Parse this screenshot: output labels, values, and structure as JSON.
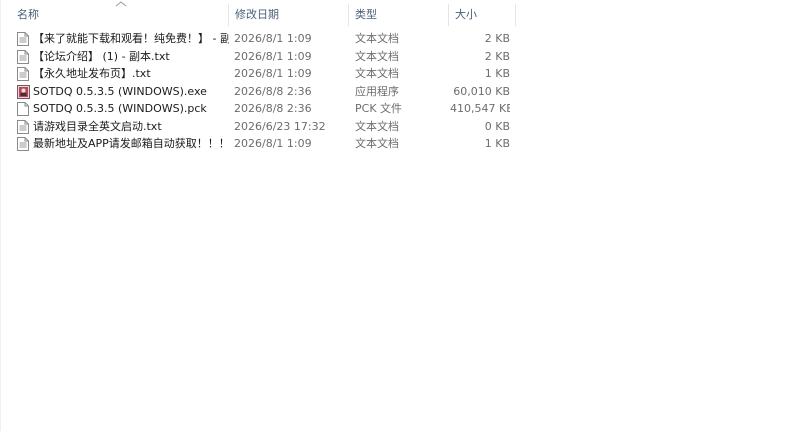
{
  "columns": {
    "name": "名称",
    "date": "修改日期",
    "type": "类型",
    "size": "大小"
  },
  "files": [
    {
      "name": "【来了就能下载和观看！纯免费！】 - 副...",
      "date": "2026/8/1 1:09",
      "type": "文本文档",
      "size": "2 KB",
      "icon": "text-file-icon"
    },
    {
      "name": "【论坛介绍】 (1) - 副本.txt",
      "date": "2026/8/1 1:09",
      "type": "文本文档",
      "size": "2 KB",
      "icon": "text-file-icon"
    },
    {
      "name": "【永久地址发布页】.txt",
      "date": "2026/8/1 1:09",
      "type": "文本文档",
      "size": "1 KB",
      "icon": "text-file-icon"
    },
    {
      "name": "SOTDQ 0.5.3.5 (WINDOWS).exe",
      "date": "2026/8/8 2:36",
      "type": "应用程序",
      "size": "60,010 KB",
      "icon": "application-icon"
    },
    {
      "name": "SOTDQ 0.5.3.5 (WINDOWS).pck",
      "date": "2026/8/8 2:36",
      "type": "PCK 文件",
      "size": "410,547 KB",
      "icon": "blank-file-icon"
    },
    {
      "name": "请游戏目录全英文启动.txt",
      "date": "2026/6/23 17:32",
      "type": "文本文档",
      "size": "0 KB",
      "icon": "text-file-icon"
    },
    {
      "name": "最新地址及APP请发邮箱自动获取！！！...",
      "date": "2026/8/1 1:09",
      "type": "文本文档",
      "size": "1 KB",
      "icon": "text-file-icon"
    }
  ]
}
